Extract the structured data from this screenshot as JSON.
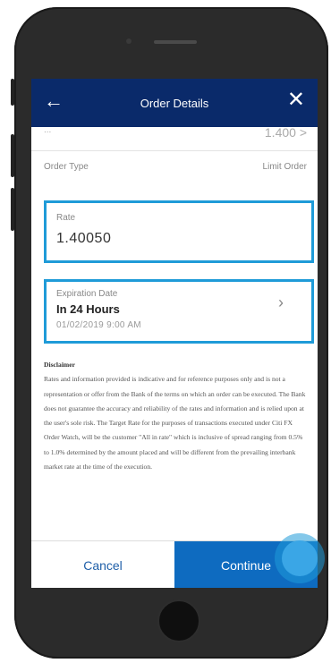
{
  "header": {
    "title": "Order Details",
    "back_icon": "arrow-left-icon",
    "close_icon": "close-icon"
  },
  "partial_row": {
    "label": "...",
    "value": "1.400 >"
  },
  "order_type": {
    "label": "Order Type",
    "value": "Limit Order"
  },
  "rate": {
    "label": "Rate",
    "value": "1.40050"
  },
  "expiration": {
    "label": "Expiration Date",
    "value": "In 24 Hours",
    "datetime": "01/02/2019 9:00 AM",
    "chevron": "›"
  },
  "disclaimer": {
    "title": "Disclaimer",
    "body": "Rates and information provided is indicative and for reference purposes only and is not a representation or offer from the Bank of the terms on which an order can be executed. The Bank does not guarantee the accuracy and reliability of the rates and information and is relied upon at the user's sole risk. The Target Rate for the purposes of transactions executed under Citi FX Order Watch, will be the customer \"All in rate\" which is inclusive of spread ranging from 0.5% to 1.0% determined by the amount placed and will be different from the prevailing interbank market rate at the time of the execution."
  },
  "footer": {
    "cancel_label": "Cancel",
    "continue_label": "Continue"
  },
  "colors": {
    "header_bg": "#0a2a6a",
    "highlight": "#1f9bd8",
    "continue_bg": "#0e6bc0"
  }
}
